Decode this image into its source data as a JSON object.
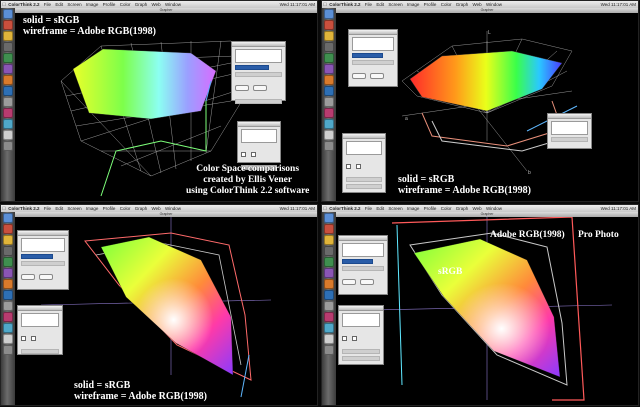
{
  "app": {
    "name": "ColorThink 2.2",
    "menu_items": [
      "File",
      "Edit",
      "Screen",
      "Image",
      "Profile",
      "Color",
      "Graph",
      "Web",
      "Window"
    ],
    "window_title": "Grapher",
    "clock": "Wed 11:17:01 AM"
  },
  "quadrants": [
    {
      "id": "top-left",
      "caption_lines": [
        "solid = sRGB",
        "wireframe = Adobe RGB(1998)"
      ]
    },
    {
      "id": "top-right",
      "axis_labels": [
        "L",
        "a",
        "b"
      ],
      "caption_lines": [
        "solid = sRGB",
        "wireframe = Adobe RGB(1998)"
      ]
    },
    {
      "id": "bottom-left",
      "caption_lines": [
        "solid = sRGB",
        "wireframe = Adobe RGB(1998)"
      ]
    },
    {
      "id": "bottom-right",
      "gamut_labels": [
        "sRGB",
        "Adobe RGB(1998)",
        "Pro Photo"
      ]
    }
  ],
  "credit_lines": [
    "Color Space comparisons",
    "created by Ellis Vener",
    "using ColorThink 2.2 software"
  ],
  "colors": {
    "srgb_solid": "#ffffff",
    "adobe_wireframe": "#c8c8c8",
    "prophoto_outline": "#ff5a5a",
    "slice_outline": "#dddddd"
  }
}
